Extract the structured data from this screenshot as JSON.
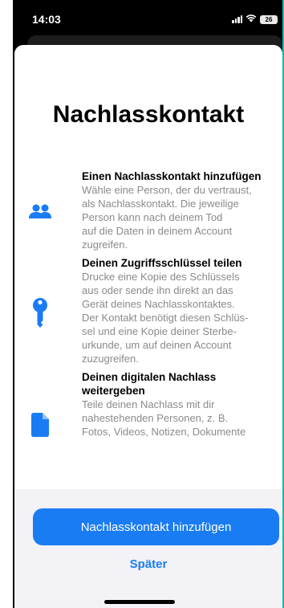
{
  "status_bar": {
    "time": "14:03",
    "battery_level": "26"
  },
  "sheet": {
    "title": "Nachlasskontakt",
    "features": [
      {
        "icon": "people-icon",
        "title": "Einen Nachlasskontakt hinzufügen",
        "lines": [
          "Wähle eine Person, der du vertraust,",
          "als Nachlasskontakt. Die jeweilige",
          "Person kann nach deinem Tod",
          "auf die Daten in deinem Account",
          "zugreifen."
        ]
      },
      {
        "icon": "key-icon",
        "title": "Deinen Zugriffsschlüssel teilen",
        "lines": [
          "Drucke eine Kopie des Schlüssels",
          "aus oder sende ihn direkt an das",
          "Gerät deines Nachlasskontaktes.",
          "Der Kontakt benötigt diesen Schlüs-",
          "sel und eine Kopie deiner Sterbe-",
          "urkunde, um auf deinen Account",
          "zuzugreifen."
        ]
      },
      {
        "icon": "document-icon",
        "title_lines": [
          "Deinen digitalen Nachlass",
          "weitergeben"
        ],
        "lines": [
          "Teile deinen Nachlass mit dir",
          "nahestehenden Personen, z. B.",
          "Fotos, Videos, Notizen, Dokumente"
        ]
      }
    ],
    "primary_button": "Nachlasskontakt hinzufügen",
    "secondary_button": "Später"
  },
  "colors": {
    "accent": "#1a7cf2",
    "secondary_text": "#8a8a8e",
    "frame_border": "#1bb9a8"
  }
}
